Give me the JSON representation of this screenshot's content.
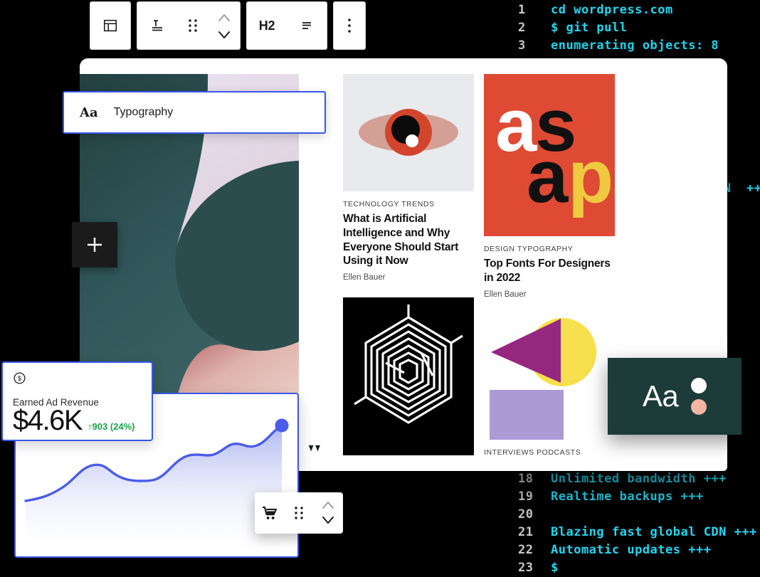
{
  "terminal": {
    "lines_top": [
      {
        "no": "1",
        "text": "cd wordpress.com"
      },
      {
        "no": "2",
        "text": "$ git pull"
      },
      {
        "no": "3",
        "text": "enumerating objects: 8"
      }
    ],
    "lines_right": [
      {
        "no": "",
        "text": "+"
      },
      {
        "no": "",
        "text": "DN  +++"
      }
    ],
    "lines_bottom": [
      {
        "no": "18",
        "text": "Unlimited bandwidth +++"
      },
      {
        "no": "19",
        "text": "Realtime backups +++"
      },
      {
        "no": "20",
        "text": ""
      },
      {
        "no": "21",
        "text": "Blazing fast global CDN +++"
      },
      {
        "no": "22",
        "text": "Automatic updates +++"
      },
      {
        "no": "23",
        "text": "$"
      }
    ],
    "prompt_color": "#21d7f0",
    "gutter_color": "#c9c9c9"
  },
  "toolbar": {
    "layout_icon": "layout-icon",
    "paragraph_icon": "paragraph-icon",
    "drag_icon": "drag-handle-icon",
    "move_up_icon": "chevron-up-icon",
    "move_down_icon": "chevron-down-icon",
    "heading_label": "H2",
    "align_icon": "align-left-icon",
    "more_icon": "more-options-icon"
  },
  "typography_panel": {
    "icon_label": "Aa",
    "label": "Typography",
    "accent": "#3858e9"
  },
  "add_block": {
    "label": "+"
  },
  "articles": [
    {
      "kicker": "TECHNOLOGY  TRENDS",
      "headline": "What is Artificial Intelligence and Why Everyone Should Start Using it Now",
      "byline": "Ellen Bauer",
      "image": "eye-illustration"
    },
    {
      "kicker": "DESIGN  TYPOGRAPHY",
      "headline": "Top Fonts For Designers in 2022",
      "byline": "Ellen Bauer",
      "image": "asap-poster"
    },
    {
      "kicker": "INTERVIEWS  PODCASTS",
      "headline": "",
      "byline": "",
      "image": "geometric-shapes"
    }
  ],
  "poster": {
    "letters": [
      "a",
      "s",
      "a",
      "p"
    ],
    "bg": "#de4a33",
    "letter_colors": [
      "#ffffff",
      "#111111",
      "#111111",
      "#efc93f"
    ]
  },
  "revenue_card": {
    "icon": "dollar-circle-icon",
    "title": "Earned Ad Revenue",
    "value": "$4.6K",
    "delta": "↑903 (24%)",
    "delta_color": "#1aa14b"
  },
  "cart_toolbar": {
    "cart_icon": "shopping-cart-icon",
    "drag_icon": "drag-handle-icon",
    "up_icon": "chevron-up-icon",
    "down_icon": "chevron-down-icon"
  },
  "aa_card": {
    "text": "Aa",
    "bg": "#1d3b38",
    "dot_white": "#ffffff",
    "dot_salmon": "#f3b5a4"
  },
  "chart_data": {
    "type": "area",
    "title": "Earned Ad Revenue",
    "xlabel": "",
    "ylabel": "",
    "line_color": "#4a5ce8",
    "fill_color": "#c3cbf5",
    "grid": false,
    "legend": null,
    "x": [
      0,
      1,
      2,
      3,
      4,
      5,
      6,
      7,
      8,
      9,
      10,
      11,
      12,
      13,
      14
    ],
    "values": [
      30,
      33,
      36,
      47,
      54,
      53,
      50,
      49,
      49,
      56,
      64,
      66,
      72,
      70,
      88
    ],
    "ylim": [
      0,
      100
    ],
    "marker_last": true
  },
  "colors": {
    "accent_blue": "#3858e9",
    "teal_dark": "#2c4d4d",
    "pink": "#efd0cc",
    "lavender": "#e7dced",
    "poster_red": "#de4a33",
    "poster_yellow": "#efc93f",
    "magenta": "#96277f",
    "yellow": "#f7e04e",
    "light_purple": "#ab9ad4"
  }
}
